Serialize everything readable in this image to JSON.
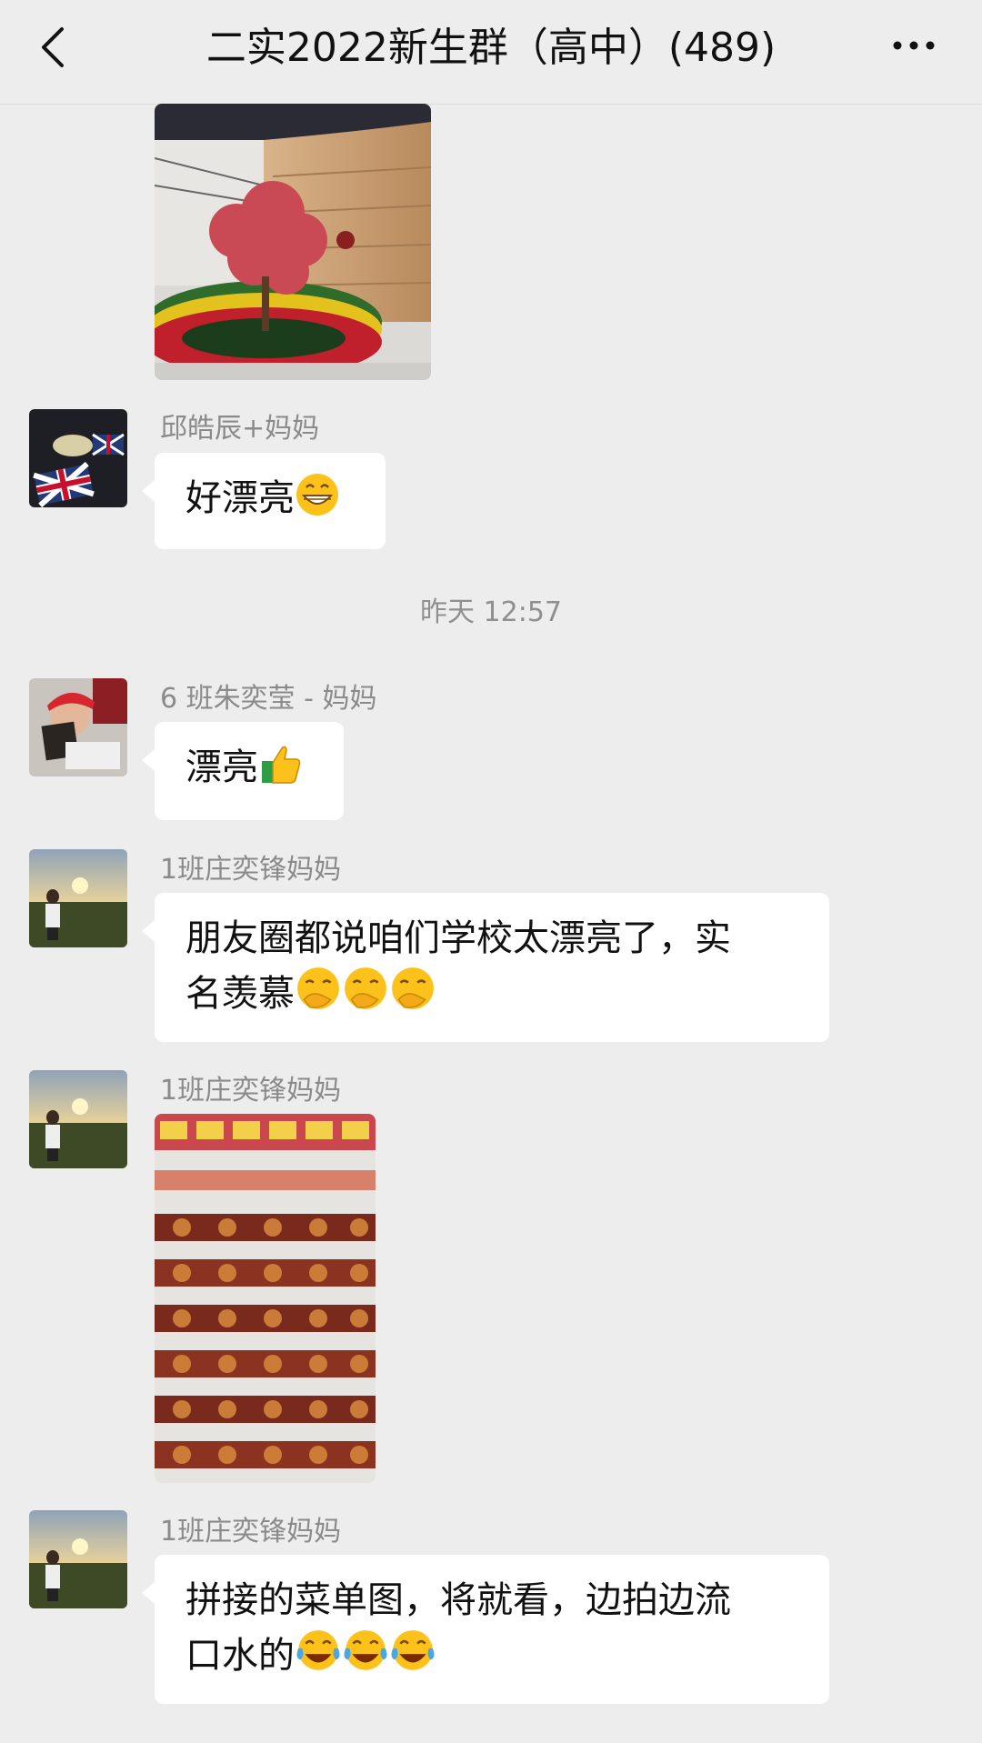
{
  "header": {
    "title": "二实2022新生群（高中）(489)",
    "back_icon": "chevron-left-icon",
    "more_icon": "more-dots-icon"
  },
  "messages": [
    {
      "type": "image",
      "description_icon": "school-lobby-photo"
    },
    {
      "sender": "邱皓辰+妈妈",
      "text": "好漂亮",
      "emoji": [
        "grinning-face"
      ]
    },
    {
      "timestamp": "昨天 12:57"
    },
    {
      "sender": "6 班朱奕莹 - 妈妈",
      "text": "漂亮",
      "emoji": [
        "thumbs-up"
      ]
    },
    {
      "sender": "1班庄奕锋妈妈",
      "text_line1": "朋友圈都说咱们学校太漂亮了，实",
      "text_line2": "名羡慕",
      "emoji": [
        "face-with-hand-over-mouth",
        "face-with-hand-over-mouth",
        "face-with-hand-over-mouth"
      ]
    },
    {
      "sender": "1班庄奕锋妈妈",
      "type": "image",
      "description_icon": "menu-board-photo"
    },
    {
      "sender": "1班庄奕锋妈妈",
      "text_line1": "拼接的菜单图，将就看，边拍边流",
      "text_line2": "口水的",
      "emoji": [
        "tears-of-joy",
        "tears-of-joy",
        "tears-of-joy"
      ]
    }
  ],
  "colors": {
    "background": "#ededed",
    "bubble": "#ffffff",
    "meta_text": "#8a8a8a"
  }
}
